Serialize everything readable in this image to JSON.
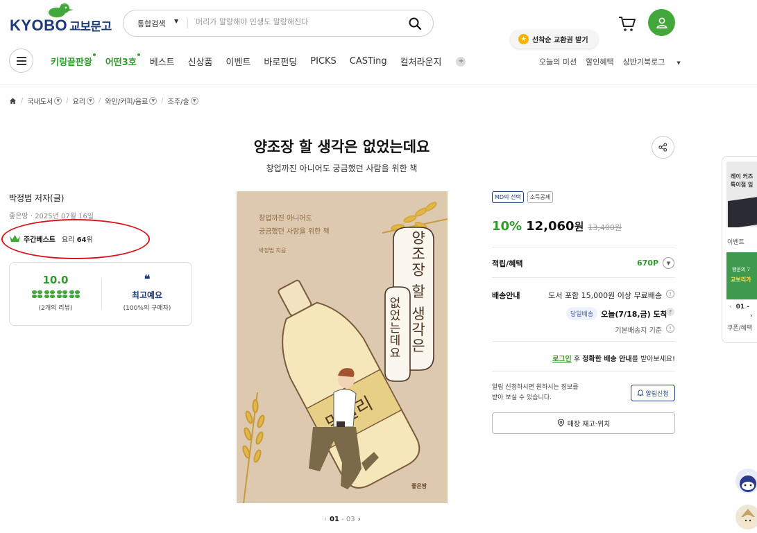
{
  "header": {
    "logo_text": "KYOBO",
    "logo_ko": "교보문고",
    "search_type": "통합검색",
    "search_placeholder": "머리가 말랑해야 인생도 말랑해진다",
    "coupon_pill": "선착순 교환권 받기"
  },
  "nav": {
    "items": [
      {
        "label": "키링끝판왕",
        "green": true,
        "dot": true
      },
      {
        "label": "어떤3호",
        "green": true,
        "dot": true
      },
      {
        "label": "베스트"
      },
      {
        "label": "신상품"
      },
      {
        "label": "이벤트"
      },
      {
        "label": "바로펀딩"
      },
      {
        "label": "PICKS"
      },
      {
        "label": "CASTing"
      },
      {
        "label": "컬처라운지"
      }
    ],
    "util": [
      "오늘의 미션",
      "할인혜택",
      "상반기북로그"
    ]
  },
  "breadcrumb": [
    "국내도서",
    "요리",
    "와인/커피/음료",
    "조주/술"
  ],
  "book": {
    "title": "양조장 할 생각은 없었는데요",
    "subtitle": "창업까진 아니어도 궁금했던 사람을 위한 책",
    "author": "박정범 저자(글)",
    "pubinfo": "좋은땅 · 2025년 07월 16일",
    "best_label": "주간베스트",
    "best_category": "요리",
    "best_rank": "64",
    "best_suffix": "위"
  },
  "review": {
    "score": "10.0",
    "count_num": "2",
    "count_text": "개의 리뷰",
    "rating_clovers": 4,
    "quote_mark": "❝",
    "emotion": "최고예요",
    "buy_pct": "100%",
    "buy_text": "의 구매자"
  },
  "cover": {
    "sub_line1": "창업까진 아니어도",
    "sub_line2": "궁금했던 사람을 위한 책",
    "author": "박정범 지음",
    "title_v1": "양조장 할 생각은",
    "title_v2": "없었는데요",
    "bottle_label": "막걸리",
    "publisher": "좋은땅"
  },
  "pager": {
    "current": "01",
    "sep": " - ",
    "total": "03"
  },
  "price": {
    "badges": [
      "MD의 선택",
      "소득공제"
    ],
    "rate": "10%",
    "price": "12,060",
    "unit": "원",
    "original": "13,400원"
  },
  "benefit": {
    "label": "적립/혜택",
    "points": "670P"
  },
  "shipping": {
    "label": "배송안내",
    "line1": "도서 포함 15,000원 이상 무료배송",
    "sameday": "당일배송",
    "arrive": "오늘(7/18,금) 도착",
    "line3": "기본배송지 기준"
  },
  "login_notice": {
    "link": "로그인",
    "mid": " 후 ",
    "bold": "정확한 배송 안내",
    "end": "를 받아보세요!"
  },
  "notify": {
    "text_line1": "알림 신청하시면 원하시는 정보를",
    "text_line2": "받아 보실 수 있습니다.",
    "button": "알림신청",
    "store_button": "매장 재고·위치"
  },
  "side_panel": {
    "img1_line1": "레이 커즈",
    "img1_line2": "특이점 입",
    "event_label": "이벤트",
    "img2_line1": "행운의 7",
    "img2_line2": "교보리가",
    "pager": "01 -",
    "coupon_label": "쿠폰/혜택"
  },
  "colors": {
    "brand_green": "#43a83b",
    "accent_green": "#2e9c2a",
    "navy": "#1b3a7a",
    "highlight_red": "#d9141c"
  }
}
